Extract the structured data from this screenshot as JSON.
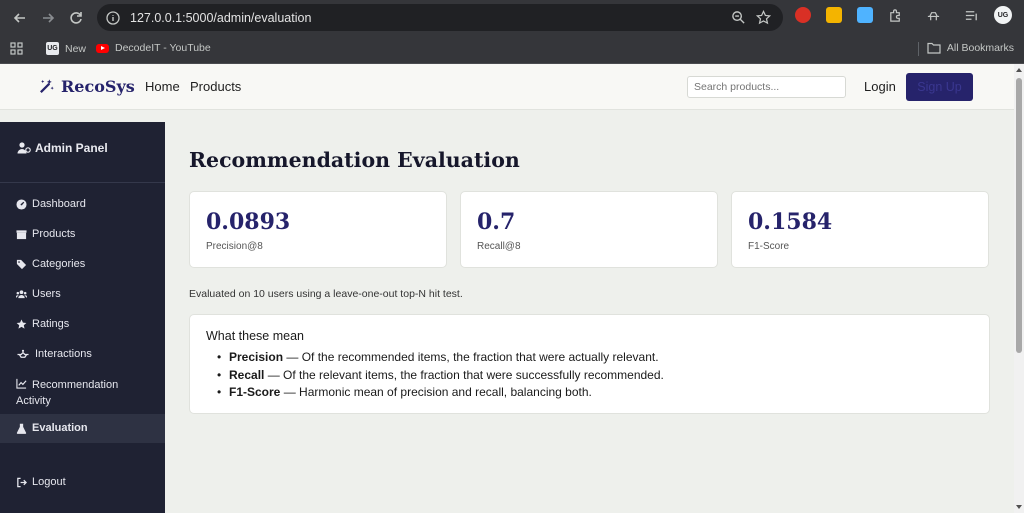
{
  "browser": {
    "url": "127.0.0.1:5000/admin/evaluation",
    "bookmarks": [
      {
        "label": "New"
      },
      {
        "label": "DecodeIT - YouTube"
      }
    ],
    "all_bookmarks": "All Bookmarks",
    "profile_initials": "UG"
  },
  "header": {
    "brand": "RecoSys",
    "nav": [
      "Home",
      "Products"
    ],
    "search_placeholder": "Search products...",
    "login": "Login",
    "signup": "Sign Up"
  },
  "sidebar": {
    "title": "Admin Panel",
    "items": [
      {
        "label": "Dashboard",
        "icon": "gauge-icon"
      },
      {
        "label": "Products",
        "icon": "box-icon"
      },
      {
        "label": "Categories",
        "icon": "tags-icon"
      },
      {
        "label": "Users",
        "icon": "users-icon"
      },
      {
        "label": "Ratings",
        "icon": "star-icon"
      },
      {
        "label": "Interactions",
        "icon": "hands-icon"
      },
      {
        "label": "Recommendation",
        "label2": "Activity",
        "icon": "chart-line-icon"
      },
      {
        "label": "Evaluation",
        "icon": "flask-icon",
        "active": true
      }
    ],
    "logout": "Logout"
  },
  "main": {
    "title": "Recommendation Evaluation",
    "metrics": [
      {
        "value": "0.0893",
        "label": "Precision@8"
      },
      {
        "value": "0.7",
        "label": "Recall@8"
      },
      {
        "value": "0.1584",
        "label": "F1-Score"
      }
    ],
    "note": "Evaluated on 10 users using a leave-one-out top-N hit test.",
    "explain": {
      "heading": "What these mean",
      "items": [
        {
          "term": "Precision",
          "text": " — Of the recommended items, the fraction that were actually relevant."
        },
        {
          "term": "Recall",
          "text": " — Of the relevant items, the fraction that were successfully recommended."
        },
        {
          "term": "F1-Score",
          "text": " — Harmonic mean of precision and recall, balancing both."
        }
      ]
    }
  },
  "colors": {
    "accent": "#26236b",
    "sidebar_bg": "#1f2233",
    "page_bg": "#eef0ec"
  }
}
